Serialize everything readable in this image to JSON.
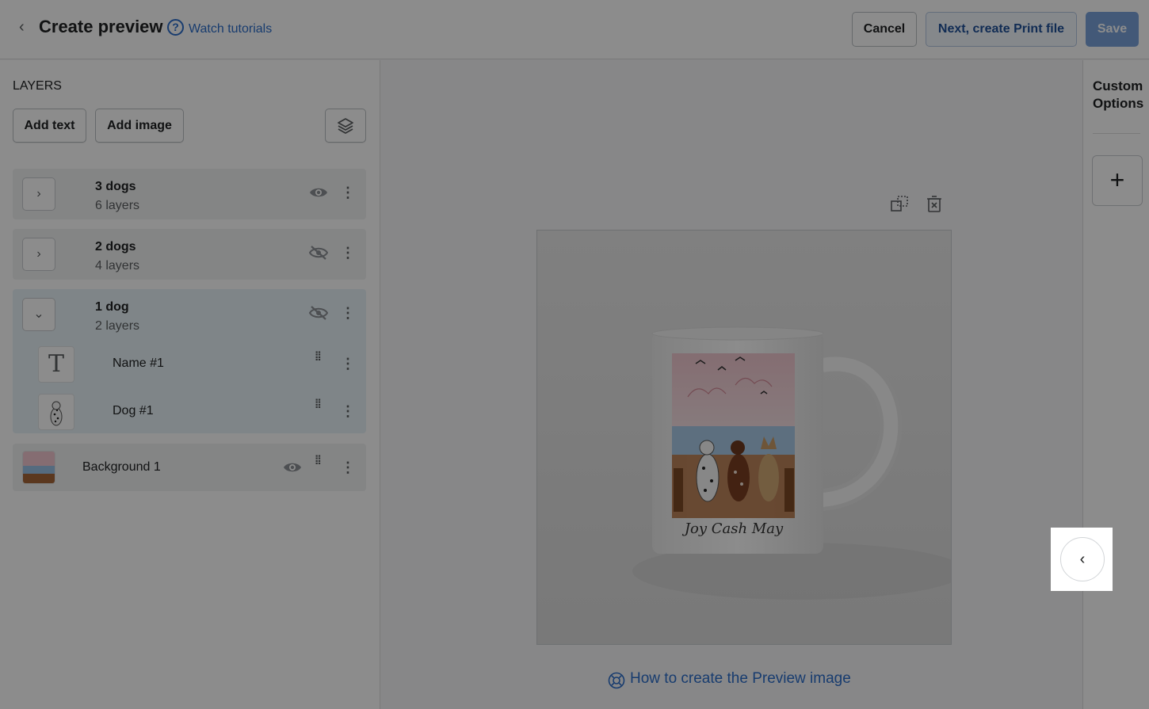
{
  "header": {
    "back_label": "<",
    "title": "Create preview",
    "help_icon": "question-circle-icon",
    "tutorials_link": "Watch tutorials",
    "cancel_label": "Cancel",
    "next_label": "Next, create Print file",
    "save_label": "Save"
  },
  "layers_panel": {
    "title": "LAYERS",
    "add_text_label": "Add text",
    "add_image_label": "Add image",
    "groups": [
      {
        "name": "3 dogs",
        "sub": "6 layers",
        "visible": true,
        "expanded": false
      },
      {
        "name": "2 dogs",
        "sub": "4 layers",
        "visible": false,
        "expanded": false
      },
      {
        "name": "1 dog",
        "sub": "2 layers",
        "visible": false,
        "expanded": true
      }
    ],
    "sub_layers": [
      {
        "name": "Name #1",
        "thumb_icon": "text-T-icon"
      },
      {
        "name": "Dog #1",
        "thumb_icon": "dog-image-thumbnail"
      }
    ],
    "background_layer": {
      "name": "Background 1",
      "visible": true
    }
  },
  "canvas": {
    "mug_names": "Joy Cash May",
    "howto_link": "How to create the Preview image"
  },
  "right_panel": {
    "title_line1": "Custom",
    "title_line2": "Options",
    "add_label": "+"
  },
  "spotlight": {
    "collapse_label": "‹"
  },
  "colors": {
    "primary": "#2c6ecb",
    "save_disabled": "#7aa3db",
    "overlay": "rgba(0,0,0,0.45)"
  }
}
